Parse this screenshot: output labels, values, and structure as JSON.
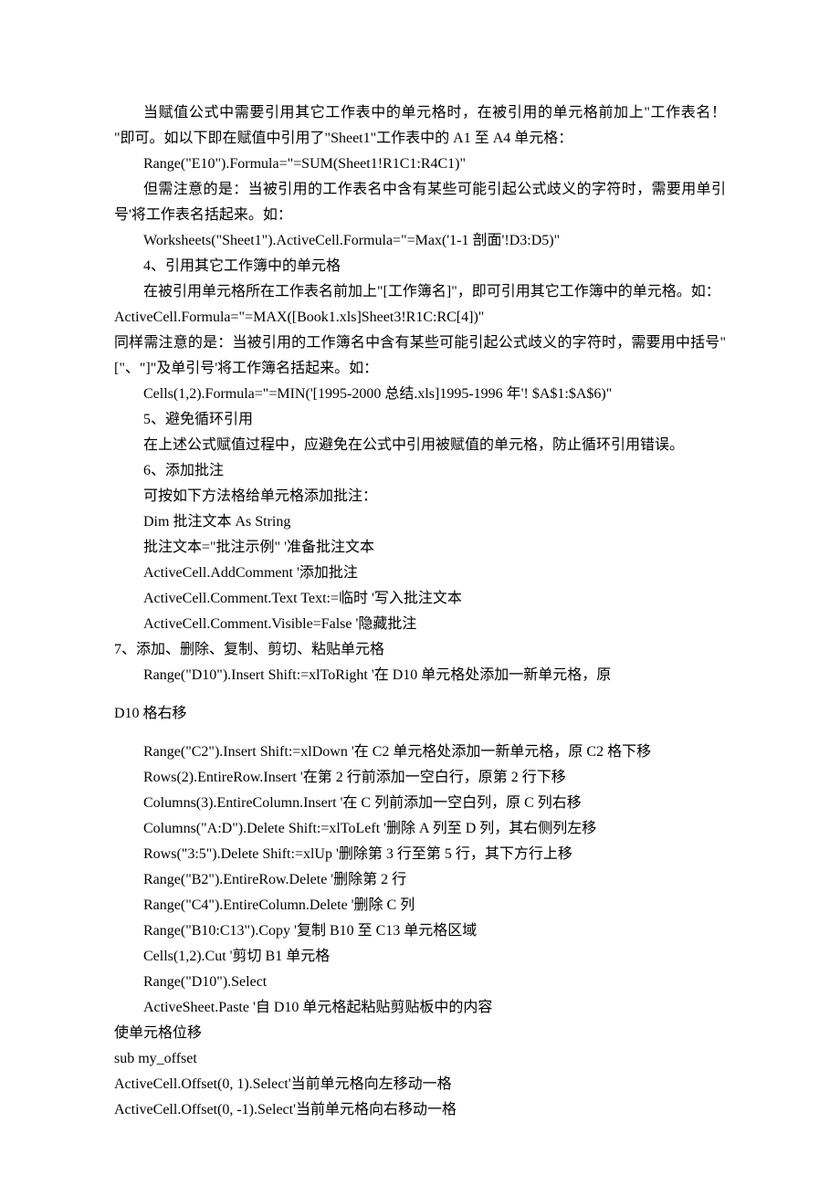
{
  "lines": {
    "l1": "当赋值公式中需要引用其它工作表中的单元格时，在被引用的单元格前加上\"工作表名！ \"即可。如以下即在赋值中引用了\"Sheet1\"工作表中的 A1 至 A4 单元格：",
    "l2": "Range(\"E10\").Formula=\"=SUM(Sheet1!R1C1:R4C1)\"",
    "l3": "但需注意的是：当被引用的工作表名中含有某些可能引起公式歧义的字符时，需要用单引号'将工作表名括起来。如：",
    "l4": "Worksheets(\"Sheet1\").ActiveCell.Formula=\"=Max('1-1 剖面'!D3:D5)\"",
    "l5": "4、引用其它工作簿中的单元格",
    "l6": "在被引用单元格所在工作表名前加上\"[工作簿名]\"，即可引用其它工作簿中的单元格。如：",
    "l7": "ActiveCell.Formula=\"=MAX([Book1.xls]Sheet3!R1C:RC[4])\"",
    "l8": "同样需注意的是：当被引用的工作簿名中含有某些可能引起公式歧义的字符时，需要用中括号\"[\"、\"]\"及单引号'将工作簿名括起来。如：",
    "l9": "Cells(1,2).Formula=\"=MIN('[1995-2000 总结.xls]1995-1996 年'! $A$1:$A$6)\"",
    "l10": "5、避免循环引用",
    "l11": "在上述公式赋值过程中，应避免在公式中引用被赋值的单元格，防止循环引用错误。",
    "l12": "6、添加批注",
    "l13": "可按如下方法格给单元格添加批注：",
    "l14": "Dim  批注文本  As String",
    "l15": "批注文本=\"批注示例\" '准备批注文本",
    "l16": "ActiveCell.AddComment '添加批注",
    "l17": "ActiveCell.Comment.Text Text:=临时  '写入批注文本",
    "l18": "ActiveCell.Comment.Visible=False '隐藏批注",
    "l19": "7、添加、删除、复制、剪切、粘贴单元格",
    "l20": "Range(\"D10\").Insert Shift:=xlToRight '在 D10 单元格处添加一新单元格，原",
    "l21": "D10 格右移",
    "l22": "Range(\"C2\").Insert Shift:=xlDown '在 C2 单元格处添加一新单元格，原 C2 格下移",
    "l23": "Rows(2).EntireRow.Insert '在第 2 行前添加一空白行，原第 2 行下移",
    "l24": "Columns(3).EntireColumn.Insert '在 C 列前添加一空白列，原 C 列右移",
    "l25": "Columns(\"A:D\").Delete Shift:=xlToLeft '删除 A 列至 D 列，其右侧列左移",
    "l26": "Rows(\"3:5\").Delete Shift:=xlUp '删除第 3 行至第 5 行，其下方行上移",
    "l27": "Range(\"B2\").EntireRow.Delete '删除第 2 行",
    "l28": "Range(\"C4\").EntireColumn.Delete '删除 C 列",
    "l29": "Range(\"B10:C13\").Copy '复制 B10 至 C13 单元格区域",
    "l30": "Cells(1,2).Cut '剪切 B1 单元格",
    "l31": "Range(\"D10\").Select",
    "l32": "ActiveSheet.Paste '自 D10 单元格起粘贴剪贴板中的内容",
    "l33": "使单元格位移",
    "l34": "sub my_offset",
    "l35": "ActiveCell.Offset(0, 1).Select'当前单元格向左移动一格",
    "l36": "ActiveCell.Offset(0, -1).Select'当前单元格向右移动一格"
  }
}
